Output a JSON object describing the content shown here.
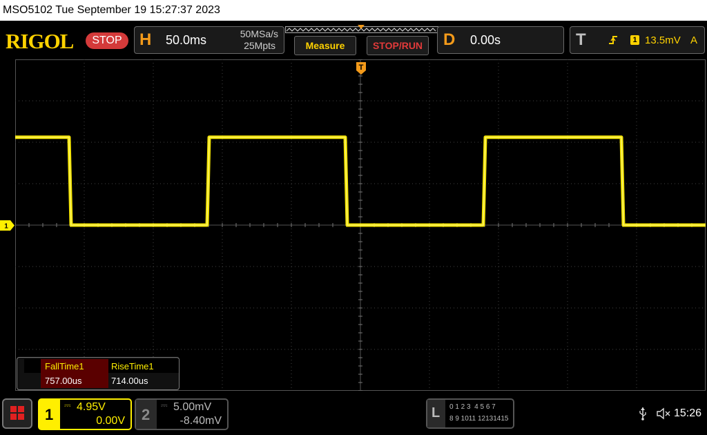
{
  "titlebar": {
    "text": "MSO5102  Tue September 19 15:27:37 2023"
  },
  "brand": {
    "logo": "RIGOL",
    "run_state": "STOP"
  },
  "horizontal": {
    "letter": "H",
    "timebase": "50.0ms",
    "sample_rate": "50MSa/s",
    "memory_depth": "25Mpts"
  },
  "buttons": {
    "measure": "Measure",
    "stop_run": "STOP/RUN"
  },
  "delay": {
    "letter": "D",
    "value": "0.00s"
  },
  "trigger": {
    "letter": "T",
    "source": "1",
    "level": "13.5mV",
    "mode": "A"
  },
  "scope": {
    "trigger_marker": "T",
    "ch1_marker": "1",
    "trace_color": "#ffef00",
    "high_level_fraction": 0.235,
    "low_level_fraction": 0.5
  },
  "measurements": {
    "headers": [
      "FallTime1",
      "RiseTime1"
    ],
    "values": [
      "757.00us",
      "714.00us"
    ]
  },
  "channels": {
    "ch1": {
      "number": "1",
      "scale": "4.95V",
      "offset": "0.00V"
    },
    "ch2": {
      "number": "2",
      "scale": "5.00mV",
      "offset": "-8.40mV"
    }
  },
  "logic": {
    "letter": "L",
    "row1": "0 1 2 3  4 5 6 7",
    "row2": "8 9 1011 12131415"
  },
  "status": {
    "clock": "15:26"
  },
  "colors": {
    "accent_yellow": "#ffd200",
    "ch1": "#ffef00",
    "stop_red": "#d43a3a",
    "orange": "#f39a1a"
  }
}
